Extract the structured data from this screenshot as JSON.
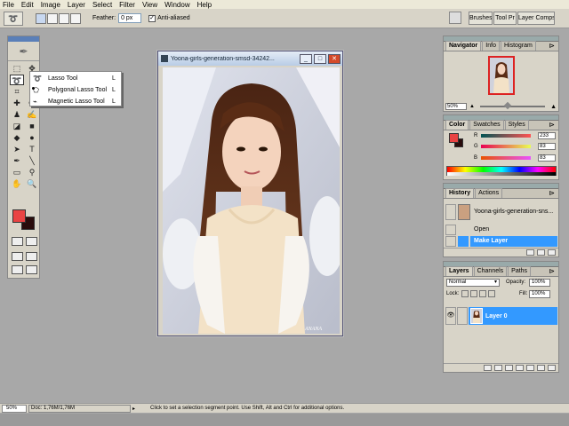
{
  "menu": [
    "File",
    "Edit",
    "Image",
    "Layer",
    "Select",
    "Filter",
    "View",
    "Window",
    "Help"
  ],
  "options": {
    "tool_icon": "lasso-icon",
    "feather_label": "Feather:",
    "feather_value": "0 px",
    "antialias_label": "Anti-aliased",
    "antialias_checked": true
  },
  "wells": [
    "Brushes",
    "Tool Pr",
    "Layer Comps"
  ],
  "toolbox": {
    "fg_color": "#e94343",
    "bg_color": "#2a0c0c"
  },
  "flyout": [
    {
      "label": "Lasso Tool",
      "key": "L",
      "icon": "lasso-icon"
    },
    {
      "label": "Polygonal Lasso Tool",
      "key": "L",
      "icon": "polygonal-lasso-icon"
    },
    {
      "label": "Magnetic Lasso Tool",
      "key": "L",
      "icon": "magnetic-lasso-icon"
    }
  ],
  "document": {
    "title": "Yoona-girls-generation-smsd-34242...",
    "watermark": "ANANA"
  },
  "navigator": {
    "tabs": [
      "Navigator",
      "Info",
      "Histogram"
    ],
    "zoom": "50%"
  },
  "color": {
    "tabs": [
      "Color",
      "Swatches",
      "Styles"
    ],
    "fg": "#e94343",
    "channels": [
      {
        "label": "R",
        "value": "233",
        "fill": 0.91
      },
      {
        "label": "G",
        "value": "83",
        "fill": 0.33
      },
      {
        "label": "B",
        "value": "83",
        "fill": 0.33
      }
    ]
  },
  "history": {
    "tabs": [
      "History",
      "Actions"
    ],
    "snapshot": "Yoona-girls-generation-sns...",
    "items": [
      "Open",
      "Make Layer"
    ]
  },
  "layers": {
    "tabs": [
      "Layers",
      "Channels",
      "Paths"
    ],
    "blend_mode": "Normal",
    "opacity_label": "Opacity:",
    "opacity": "100%",
    "lock_label": "Lock:",
    "fill_label": "Fill:",
    "fill": "100%",
    "layer_name": "Layer 0"
  },
  "status": {
    "zoom": "50%",
    "doc": "Doc: 1,76M/1,76M",
    "message": "Click to set a selection segment point.  Use Shift, Alt and Ctrl for additional options."
  }
}
